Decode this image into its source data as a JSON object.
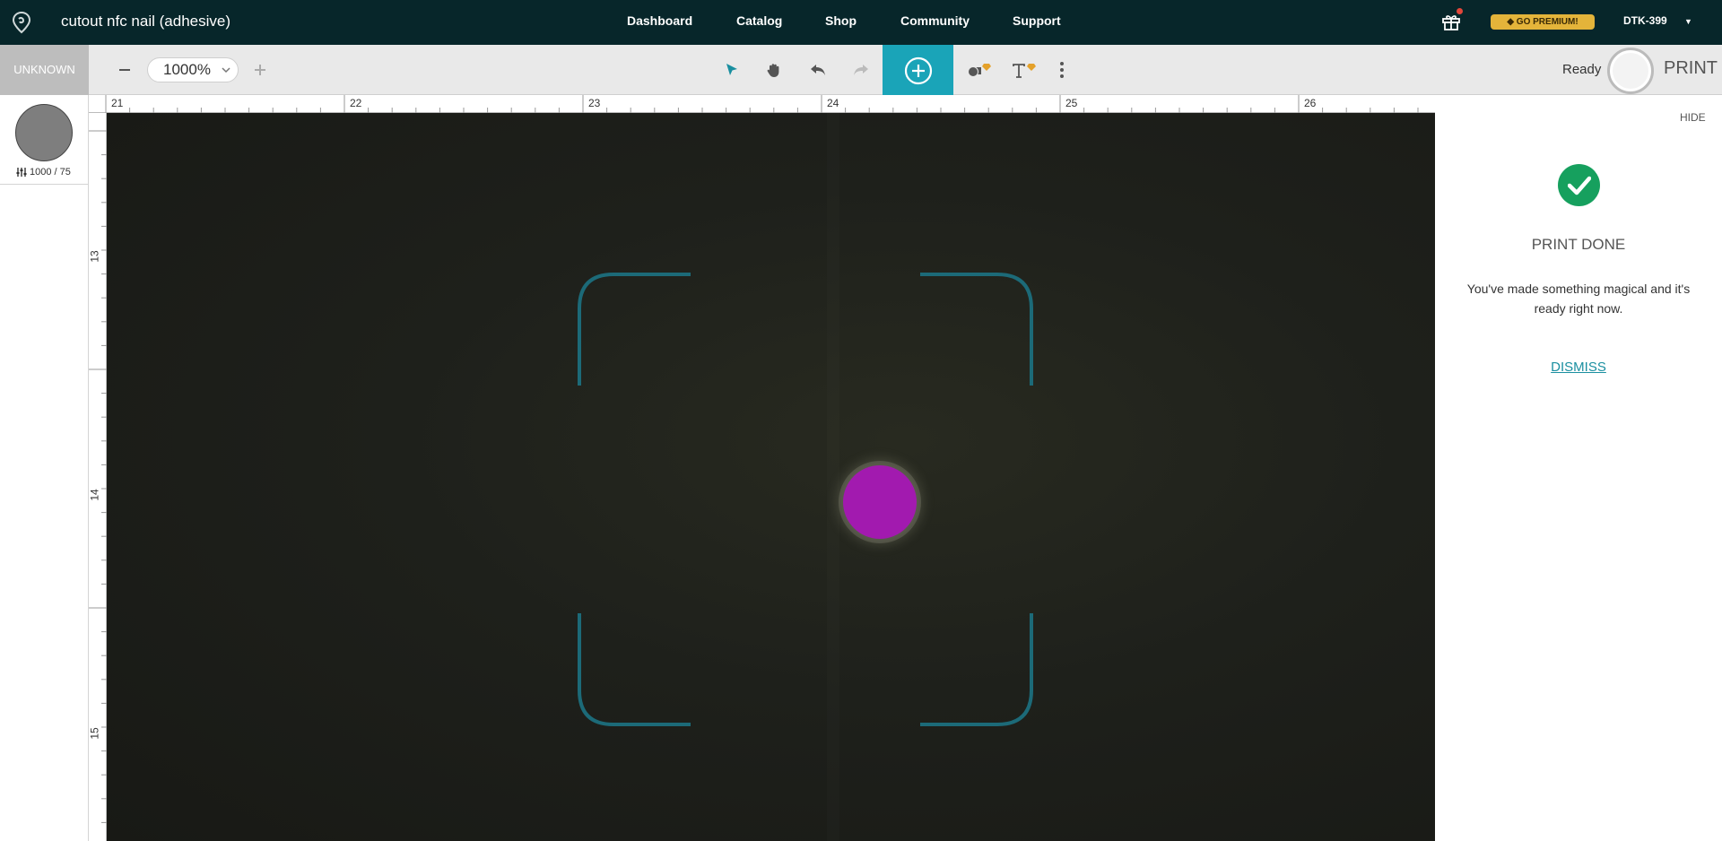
{
  "app": {
    "title": "cutout nfc nail (adhesive)",
    "logo_icon": "location-pin-logo-icon"
  },
  "nav": {
    "items": [
      "Dashboard",
      "Catalog",
      "Shop",
      "Community",
      "Support"
    ]
  },
  "header_right": {
    "gift_icon": "gift-icon",
    "premium_label": "GO PREMIUM!",
    "device_name": "DTK-399"
  },
  "toolbar": {
    "material_label": "UNKNOWN",
    "zoom_value": "1000%",
    "status": "Ready",
    "print_label": "PRINT",
    "icons": [
      "zoom-out-icon",
      "zoom-in-icon",
      "select-arrow-icon",
      "hand-pan-icon",
      "undo-icon",
      "redo-icon",
      "add-circle-icon",
      "shapes-icon",
      "text-icon",
      "more-vertical-icon"
    ]
  },
  "thumbnail": {
    "power_speed": "1000 / 75",
    "settings_icon": "sliders-icon"
  },
  "rulers": {
    "horizontal": [
      "21",
      "22",
      "23",
      "24",
      "25",
      "26"
    ],
    "vertical": [
      "13",
      "14",
      "15"
    ]
  },
  "panel": {
    "hide_label": "HIDE",
    "title": "PRINT DONE",
    "message": "You've made something magical and it's ready right now.",
    "dismiss_label": "DISMISS"
  },
  "colors": {
    "nav_bg": "#07262a",
    "accent": "#1aa4b8",
    "premium": "#e4b43a",
    "success": "#16a05e",
    "object": "#a21aaf"
  }
}
